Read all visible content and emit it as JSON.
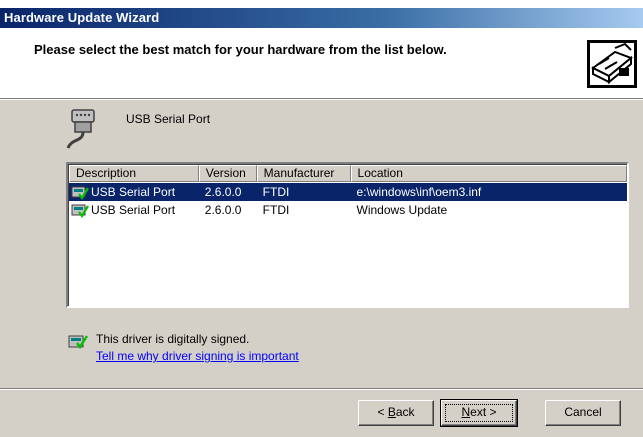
{
  "window": {
    "title": "Hardware Update Wizard"
  },
  "header": {
    "heading": "Please select the best match for your hardware from the list below."
  },
  "device": {
    "name": "USB Serial Port"
  },
  "list": {
    "columns": [
      "Description",
      "Version",
      "Manufacturer",
      "Location"
    ],
    "rows": [
      {
        "description": "USB Serial Port",
        "version": "2.6.0.0",
        "manufacturer": "FTDI",
        "location": "e:\\windows\\inf\\oem3.inf",
        "selected": true
      },
      {
        "description": "USB Serial Port",
        "version": "2.6.0.0",
        "manufacturer": "FTDI",
        "location": "Windows Update",
        "selected": false
      }
    ]
  },
  "signing": {
    "status_text": "This driver is digitally signed.",
    "link_text": "Tell me why driver signing is important"
  },
  "buttons": {
    "back": {
      "prefix": "< ",
      "accel": "B",
      "rest": "ack"
    },
    "next": {
      "accel": "N",
      "rest": "ext >"
    },
    "cancel": "Cancel"
  },
  "icons": {
    "header": "hardware-wizard-icon",
    "device": "serial-port-icon",
    "driver": "signed-driver-icon"
  },
  "colors": {
    "titlebar_start": "#0a246a",
    "titlebar_end": "#a6caf0",
    "dialog_face": "#d4d0c8",
    "selection": "#0a246a",
    "link": "#0000ff"
  }
}
